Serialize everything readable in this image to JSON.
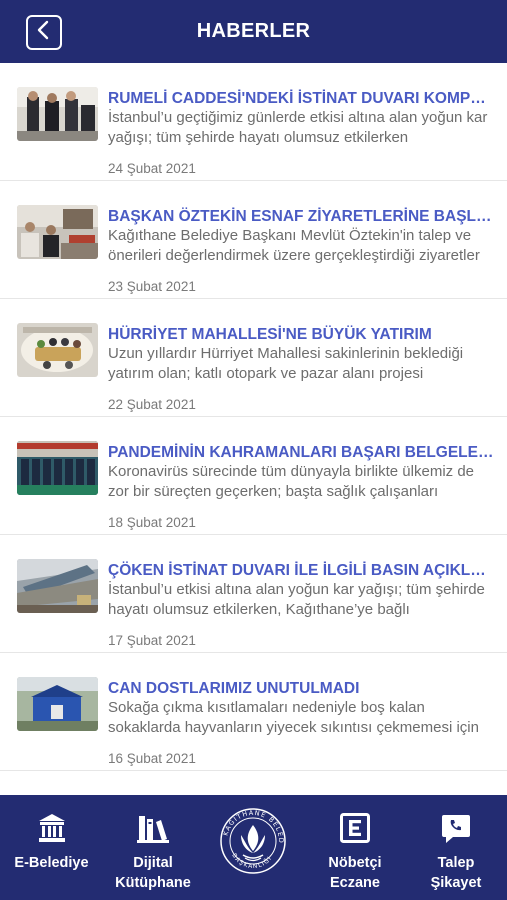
{
  "header": {
    "title": "HABERLER",
    "back_icon": "chevron-left-icon"
  },
  "news": [
    {
      "title": "RUMELİ CADDESİ'NDEKİ İSTİNAT DUVARI KOMPLE YENİLENİYOR",
      "summary": "İstanbul’u geçtiğimiz günlerde etkisi altına alan yoğun kar yağışı; tüm şehirde hayatı olumsuz etkilerken",
      "date": "24 Şubat 2021"
    },
    {
      "title": "BAŞKAN ÖZTEKİN ESNAF ZİYARETLERİNE BAŞLADI",
      "summary": "Kağıthane Belediye Başkanı Mevlüt Öztekin'in talep ve önerileri değerlendirmek üzere gerçekleştirdiği ziyaretler",
      "date": "23 Şubat 2021"
    },
    {
      "title": "HÜRRİYET MAHALLESİ'NE BÜYÜK YATIRIM",
      "summary": "Uzun yıllardır Hürriyet Mahallesi sakinlerinin beklediği yatırım olan; katlı otopark ve pazar alanı projesi",
      "date": "22 Şubat 2021"
    },
    {
      "title": "PANDEMİNİN KAHRAMANLARI BAŞARI BELGELERİNİ ALDI",
      "summary": "Koronavirüs sürecinde tüm dünyayla birlikte ülkemiz de zor bir süreçten geçerken; başta sağlık çalışanları",
      "date": "18 Şubat 2021"
    },
    {
      "title": "ÇÖKEN İSTİNAT DUVARI İLE İLGİLİ BASIN AÇIKLAMASI",
      "summary": "İstanbul’u etkisi altına alan yoğun kar yağışı; tüm şehirde hayatı olumsuz etkilerken, Kağıthane’ye bağlı",
      "date": "17 Şubat 2021"
    },
    {
      "title": "CAN DOSTLARIMIZ UNUTULMADI",
      "summary": "Sokağa çıkma kısıtlamaları nedeniyle boş kalan sokaklarda hayvanların yiyecek sıkıntısı çekmemesi için",
      "date": "16 Şubat 2021"
    }
  ],
  "bottom_nav": {
    "items": [
      {
        "label": "E-Belediye",
        "icon": "bank-building-icon"
      },
      {
        "label": "Dijital\nKütüphane",
        "icon": "books-icon"
      },
      {
        "label": "Nöbetçi\nEczane",
        "icon": "pharmacy-e-icon"
      },
      {
        "label": "Talep\nŞikayet",
        "icon": "phone-chat-icon"
      }
    ],
    "logo": {
      "text": "KAĞITHANE BELEDİYE BAŞKANLIĞI",
      "icon": "municipality-logo-icon"
    }
  },
  "colors": {
    "primary": "#232c72",
    "title_blue": "#4a5bc4",
    "summary_gray": "#6d6d6d",
    "date_gray": "#7a7a7a"
  }
}
